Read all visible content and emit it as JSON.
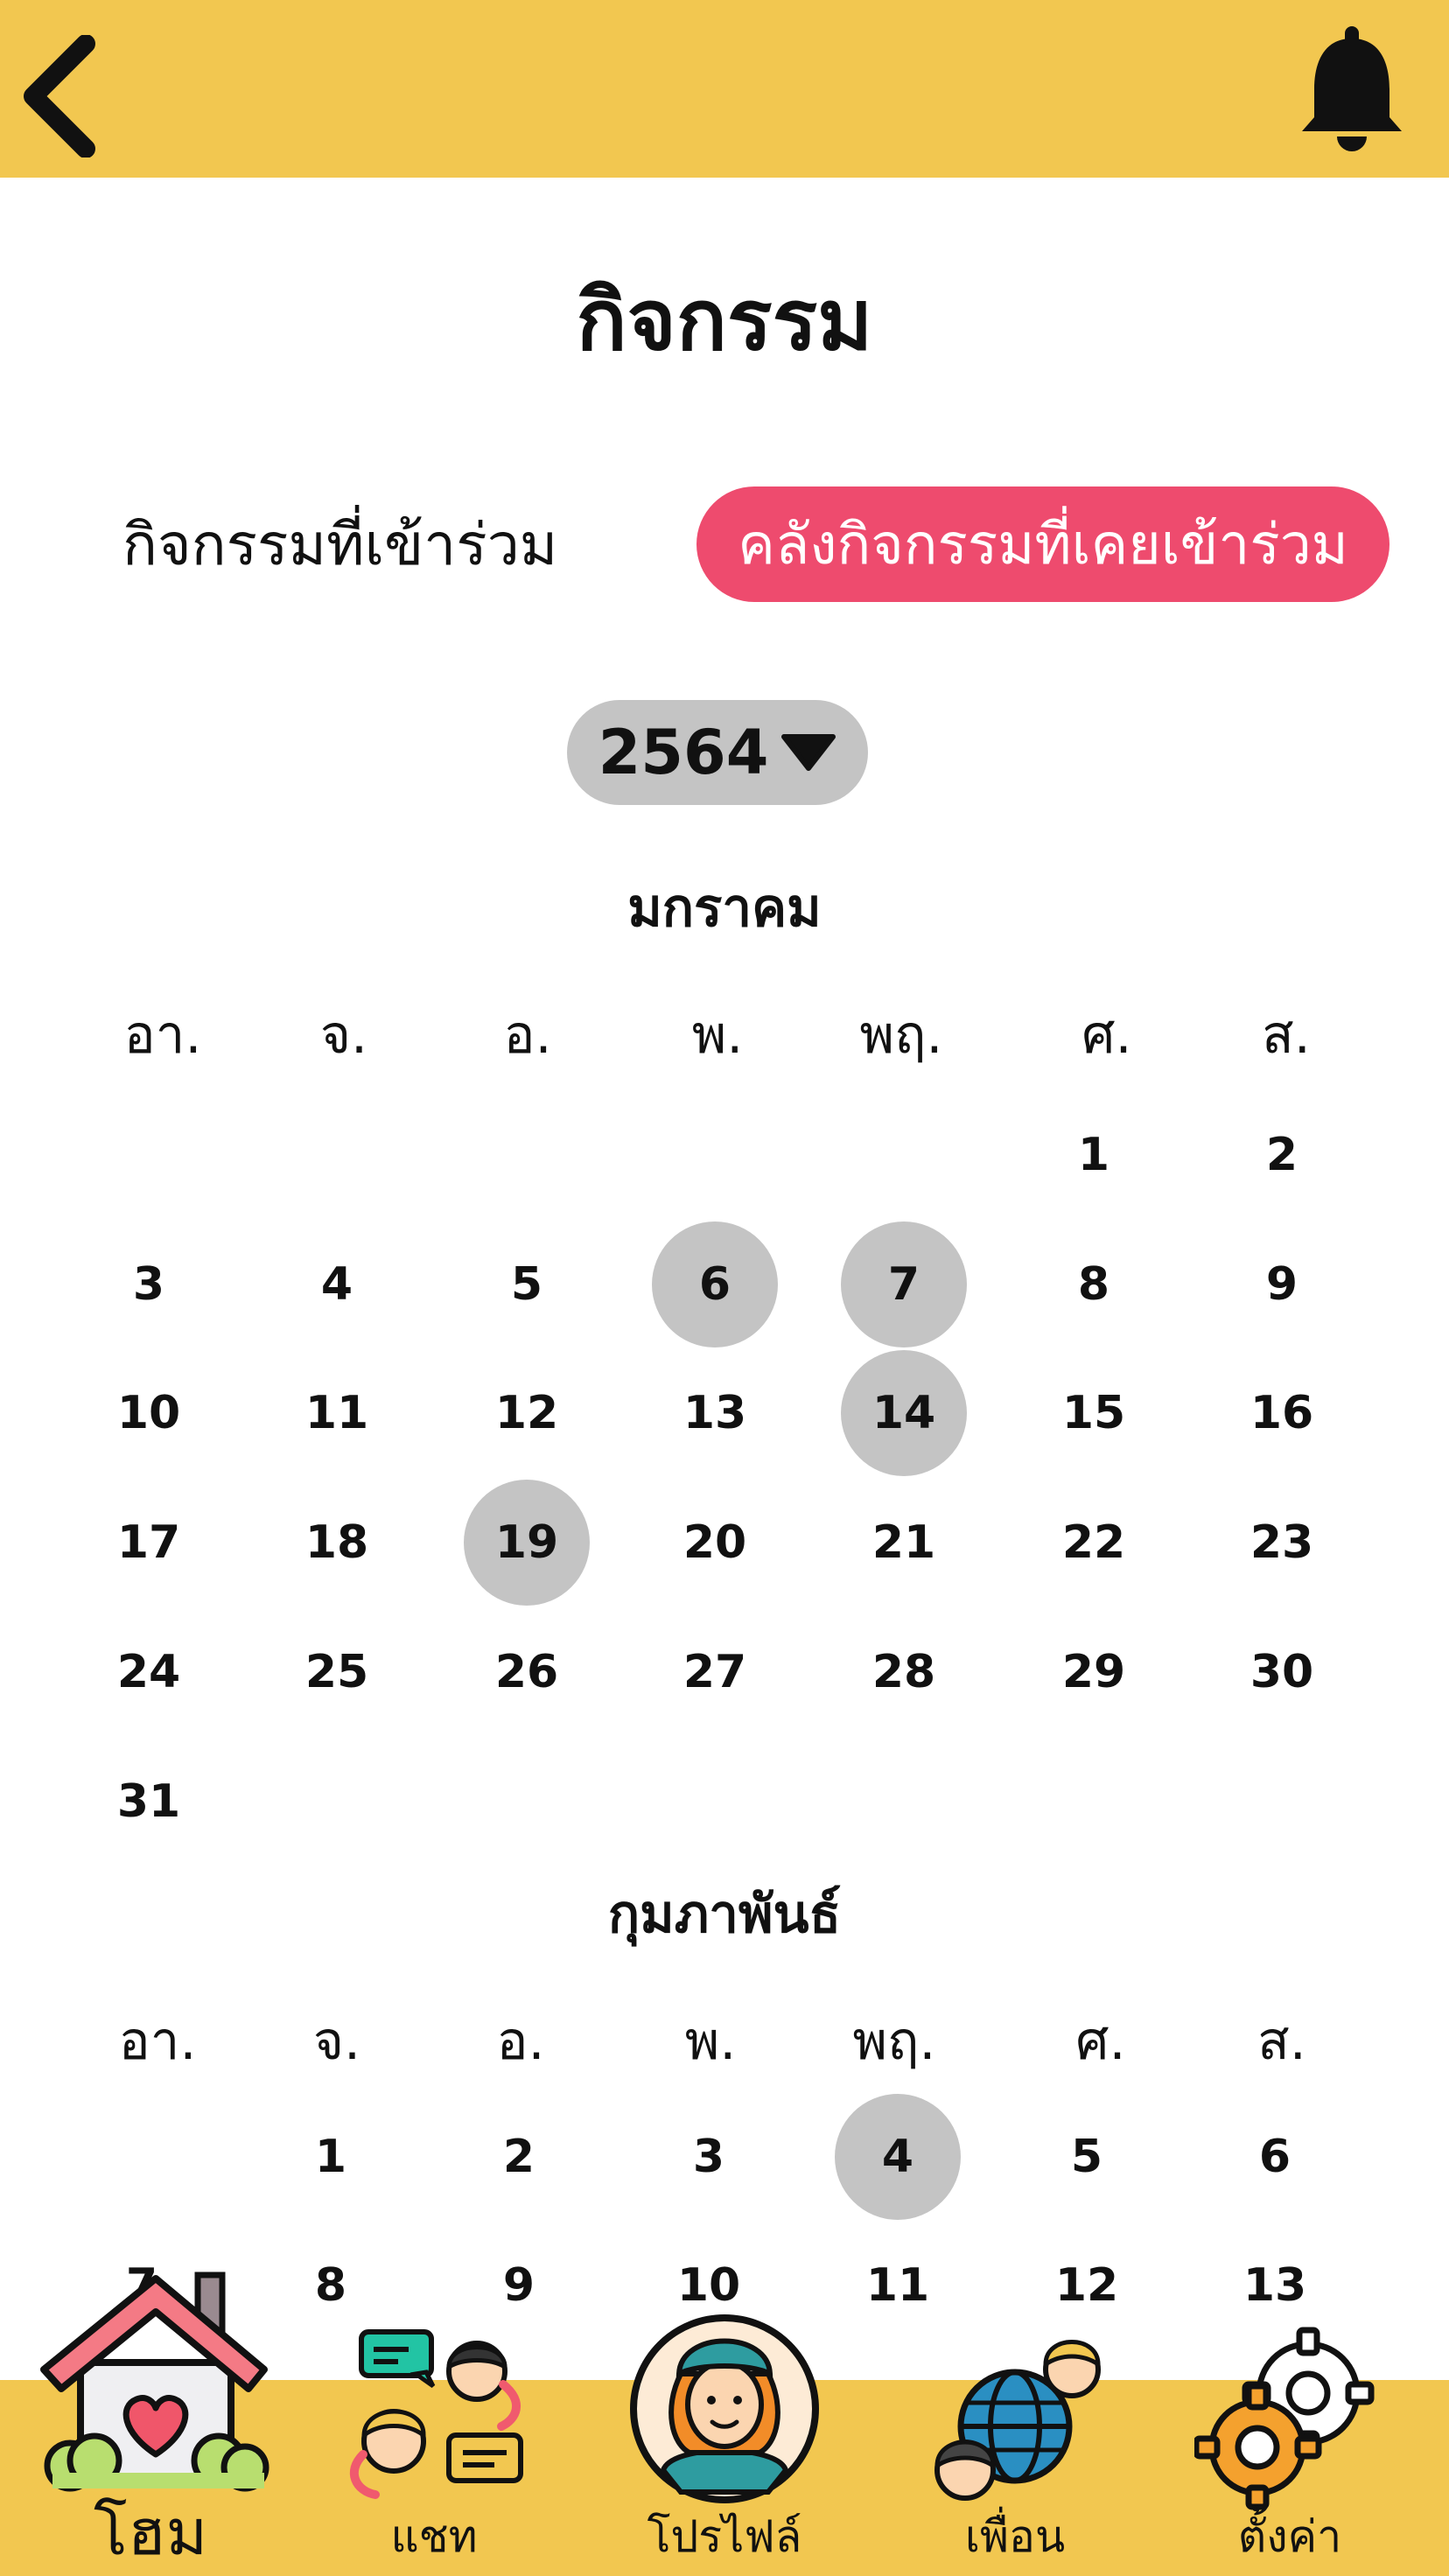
{
  "header": {
    "back_icon": "back-chevron-icon",
    "bell_icon": "bell-icon"
  },
  "page": {
    "title": "กิจกรรม"
  },
  "tabs": {
    "joined": "กิจกรรมที่เข้าร่วม",
    "archive": "คลังกิจกรรมที่เคยเข้าร่วม"
  },
  "year_selector": {
    "value": "2564",
    "icon": "caret-down-icon"
  },
  "weekdays": [
    "อา.",
    "จ.",
    "อ.",
    "พ.",
    "พฤ.",
    "ศ.",
    "ส."
  ],
  "colors": {
    "accent": "#F2C750",
    "active_tab": "#EE4B6E",
    "highlight": "#C4C4C4"
  },
  "months": [
    {
      "name": "มกราคม",
      "weeks": [
        [
          "",
          "",
          "",
          "",
          "",
          "1",
          "2"
        ],
        [
          "3",
          "4",
          "5",
          "6",
          "7",
          "8",
          "9"
        ],
        [
          "10",
          "11",
          "12",
          "13",
          "14",
          "15",
          "16"
        ],
        [
          "17",
          "18",
          "19",
          "20",
          "21",
          "22",
          "23"
        ],
        [
          "24",
          "25",
          "26",
          "27",
          "28",
          "29",
          "30"
        ],
        [
          "31",
          "",
          "",
          "",
          "",
          "",
          ""
        ]
      ],
      "highlighted": [
        "6",
        "7",
        "14",
        "19"
      ]
    },
    {
      "name": "กุมภาพันธ์",
      "weeks": [
        [
          "",
          "1",
          "2",
          "3",
          "4",
          "5",
          "6"
        ],
        [
          "7",
          "8",
          "9",
          "10",
          "11",
          "12",
          "13"
        ]
      ],
      "highlighted": [
        "4"
      ]
    }
  ],
  "bottom_nav": [
    {
      "label": "โฮม",
      "icon": "home-icon"
    },
    {
      "label": "แชท",
      "icon": "chat-icon"
    },
    {
      "label": "โปรไฟล์",
      "icon": "profile-avatar-icon"
    },
    {
      "label": "เพื่อน",
      "icon": "friends-globe-icon"
    },
    {
      "label": "ตั้งค่า",
      "icon": "settings-gear-icon"
    }
  ]
}
